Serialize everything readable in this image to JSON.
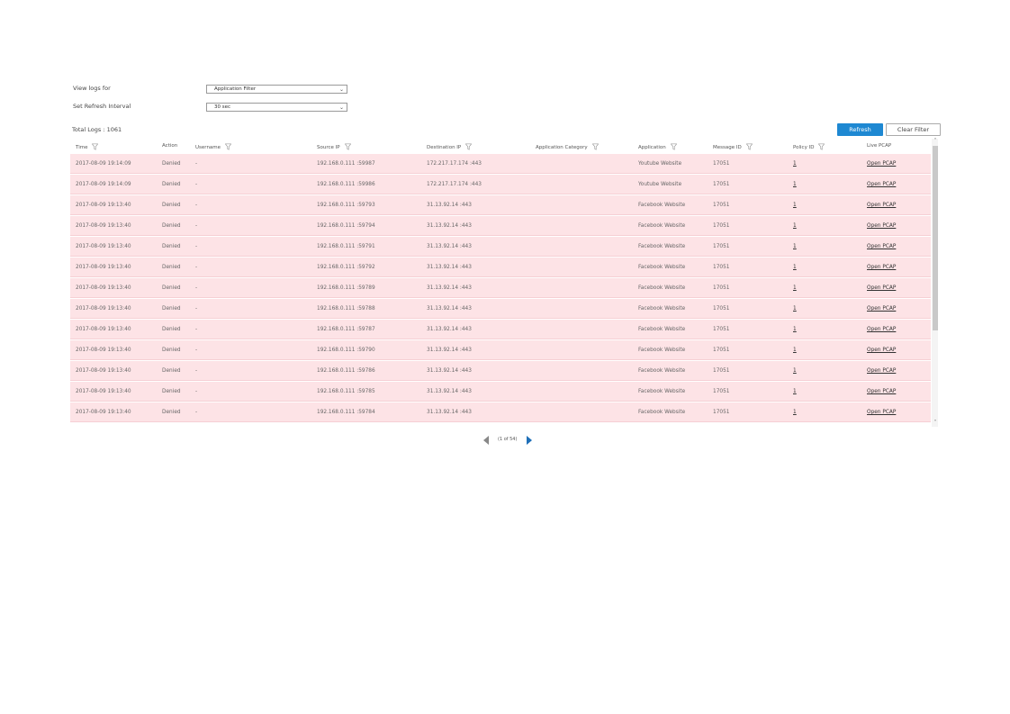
{
  "filters": {
    "view_logs_label": "View logs for",
    "view_logs_value": "Application Filter",
    "refresh_interval_label": "Set Refresh Interval",
    "refresh_interval_value": "30 sec"
  },
  "summary": {
    "total_logs": "Total Logs : 1061"
  },
  "buttons": {
    "refresh": "Refresh",
    "clear_filter": "Clear Filter"
  },
  "columns": [
    {
      "label": "Time",
      "filterable": true
    },
    {
      "label": "Action",
      "filterable": false
    },
    {
      "label": "Username",
      "filterable": true
    },
    {
      "label": "Source IP",
      "filterable": true
    },
    {
      "label": "Destination IP",
      "filterable": true
    },
    {
      "label": "Application Category",
      "filterable": true
    },
    {
      "label": "Application",
      "filterable": true
    },
    {
      "label": "Message ID",
      "filterable": true
    },
    {
      "label": "Policy ID",
      "filterable": true
    },
    {
      "label": "Live PCAP",
      "filterable": false
    }
  ],
  "rows": [
    {
      "time": "2017-08-09 19:14:09",
      "action": "Denied",
      "username": "-",
      "source_ip": "192.168.0.111 :59987",
      "dest_ip": "172.217.17.174 :443",
      "category": "",
      "application": "Youtube Website",
      "message_id": "17051",
      "policy_id": "1",
      "pcap": "Open PCAP"
    },
    {
      "time": "2017-08-09 19:14:09",
      "action": "Denied",
      "username": "-",
      "source_ip": "192.168.0.111 :59986",
      "dest_ip": "172.217.17.174 :443",
      "category": "",
      "application": "Youtube Website",
      "message_id": "17051",
      "policy_id": "1",
      "pcap": "Open PCAP"
    },
    {
      "time": "2017-08-09 19:13:40",
      "action": "Denied",
      "username": "-",
      "source_ip": "192.168.0.111 :59793",
      "dest_ip": "31.13.92.14 :443",
      "category": "",
      "application": "Facebook Website",
      "message_id": "17051",
      "policy_id": "1",
      "pcap": "Open PCAP"
    },
    {
      "time": "2017-08-09 19:13:40",
      "action": "Denied",
      "username": "-",
      "source_ip": "192.168.0.111 :59794",
      "dest_ip": "31.13.92.14 :443",
      "category": "",
      "application": "Facebook Website",
      "message_id": "17051",
      "policy_id": "1",
      "pcap": "Open PCAP"
    },
    {
      "time": "2017-08-09 19:13:40",
      "action": "Denied",
      "username": "-",
      "source_ip": "192.168.0.111 :59791",
      "dest_ip": "31.13.92.14 :443",
      "category": "",
      "application": "Facebook Website",
      "message_id": "17051",
      "policy_id": "1",
      "pcap": "Open PCAP"
    },
    {
      "time": "2017-08-09 19:13:40",
      "action": "Denied",
      "username": "-",
      "source_ip": "192.168.0.111 :59792",
      "dest_ip": "31.13.92.14 :443",
      "category": "",
      "application": "Facebook Website",
      "message_id": "17051",
      "policy_id": "1",
      "pcap": "Open PCAP"
    },
    {
      "time": "2017-08-09 19:13:40",
      "action": "Denied",
      "username": "-",
      "source_ip": "192.168.0.111 :59789",
      "dest_ip": "31.13.92.14 :443",
      "category": "",
      "application": "Facebook Website",
      "message_id": "17051",
      "policy_id": "1",
      "pcap": "Open PCAP"
    },
    {
      "time": "2017-08-09 19:13:40",
      "action": "Denied",
      "username": "-",
      "source_ip": "192.168.0.111 :59788",
      "dest_ip": "31.13.92.14 :443",
      "category": "",
      "application": "Facebook Website",
      "message_id": "17051",
      "policy_id": "1",
      "pcap": "Open PCAP"
    },
    {
      "time": "2017-08-09 19:13:40",
      "action": "Denied",
      "username": "-",
      "source_ip": "192.168.0.111 :59787",
      "dest_ip": "31.13.92.14 :443",
      "category": "",
      "application": "Facebook Website",
      "message_id": "17051",
      "policy_id": "1",
      "pcap": "Open PCAP"
    },
    {
      "time": "2017-08-09 19:13:40",
      "action": "Denied",
      "username": "-",
      "source_ip": "192.168.0.111 :59790",
      "dest_ip": "31.13.92.14 :443",
      "category": "",
      "application": "Facebook Website",
      "message_id": "17051",
      "policy_id": "1",
      "pcap": "Open PCAP"
    },
    {
      "time": "2017-08-09 19:13:40",
      "action": "Denied",
      "username": "-",
      "source_ip": "192.168.0.111 :59786",
      "dest_ip": "31.13.92.14 :443",
      "category": "",
      "application": "Facebook Website",
      "message_id": "17051",
      "policy_id": "1",
      "pcap": "Open PCAP"
    },
    {
      "time": "2017-08-09 19:13:40",
      "action": "Denied",
      "username": "-",
      "source_ip": "192.168.0.111 :59785",
      "dest_ip": "31.13.92.14 :443",
      "category": "",
      "application": "Facebook Website",
      "message_id": "17051",
      "policy_id": "1",
      "pcap": "Open PCAP"
    },
    {
      "time": "2017-08-09 19:13:40",
      "action": "Denied",
      "username": "-",
      "source_ip": "192.168.0.111 :59784",
      "dest_ip": "31.13.92.14 :443",
      "category": "",
      "application": "Facebook Website",
      "message_id": "17051",
      "policy_id": "1",
      "pcap": "Open PCAP"
    }
  ],
  "pagination": {
    "label": "(1 of 54)"
  },
  "colors": {
    "row_background": "#fde3e6",
    "primary_button": "#1e88d2"
  }
}
